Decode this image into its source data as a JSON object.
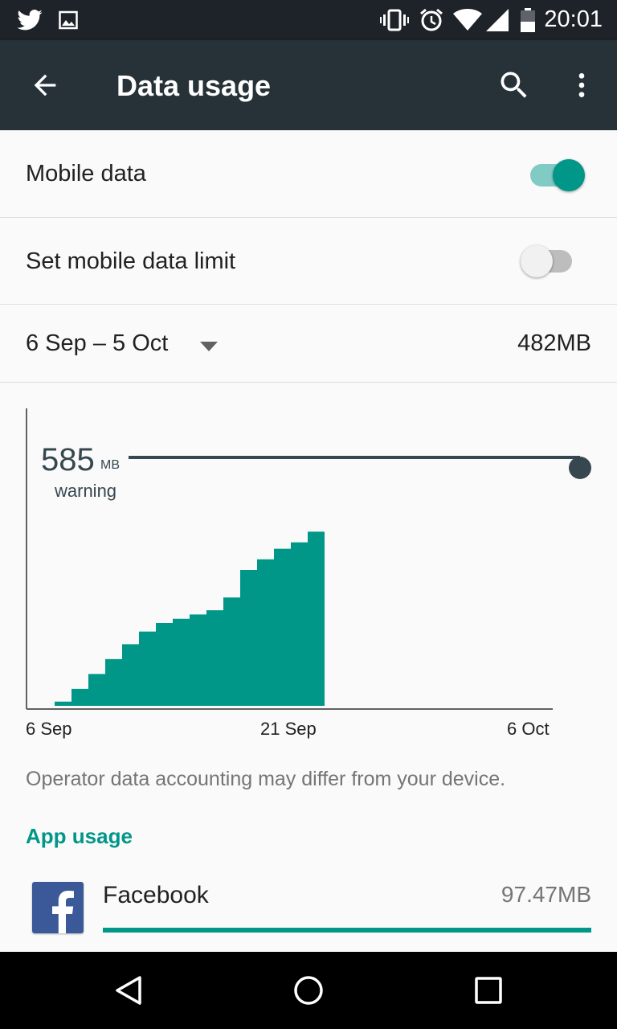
{
  "status_bar": {
    "time": "20:01",
    "icons": [
      "twitter-icon",
      "gallery-icon",
      "vibrate-icon",
      "alarm-icon",
      "wifi-icon",
      "signal-icon",
      "battery-icon"
    ]
  },
  "app_bar": {
    "title": "Data usage",
    "back_icon": "arrow-back-icon",
    "search_icon": "search-icon",
    "menu_icon": "more-vert-icon"
  },
  "mobile_data": {
    "label": "Mobile data",
    "enabled": true
  },
  "data_limit": {
    "label": "Set mobile data limit",
    "enabled": false
  },
  "cycle": {
    "range": "6 Sep – 5 Oct",
    "total": "482MB"
  },
  "chart_data": {
    "type": "area",
    "x_ticks": [
      "6 Sep",
      "21 Sep",
      "6 Oct"
    ],
    "warning": {
      "value": "585",
      "unit": "MB",
      "label": "warning"
    },
    "x_days": [
      0,
      1,
      2,
      3,
      4,
      5,
      6,
      7,
      8,
      9,
      10,
      11,
      12,
      13,
      14,
      15
    ],
    "cumulative_mb": [
      10,
      40,
      75,
      110,
      145,
      175,
      195,
      205,
      215,
      225,
      255,
      320,
      345,
      370,
      385,
      410
    ],
    "ylim": [
      0,
      585
    ],
    "colors": {
      "fill": "#009688",
      "warning_line": "#37474f",
      "axis": "#616161"
    }
  },
  "note": "Operator data accounting may differ from your device.",
  "app_usage": {
    "header": "App usage",
    "apps": [
      {
        "name": "Facebook",
        "amount": "97.47MB",
        "fraction": 1.0,
        "icon": "facebook-icon"
      }
    ]
  },
  "colors": {
    "accent": "#009688",
    "app_bar": "#263238",
    "status_bar": "#1e2329"
  }
}
